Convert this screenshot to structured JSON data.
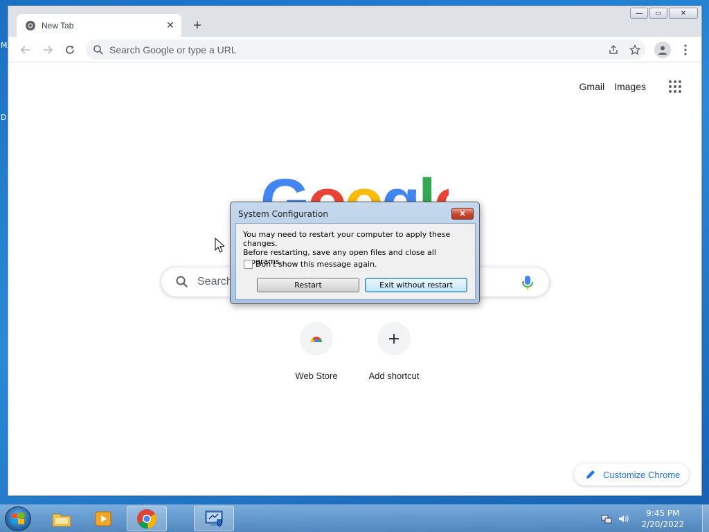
{
  "desktop": {
    "label_1": "M",
    "label_2": "D"
  },
  "browser": {
    "tab_title": "New Tab",
    "tab_close_glyph": "✕",
    "new_tab_glyph": "+",
    "omnibox_placeholder": "Search Google or type a URL",
    "window_controls": {
      "minimize": "—",
      "maximize": "▭",
      "close": "✕"
    }
  },
  "ntp": {
    "top_links": [
      "Gmail",
      "Images"
    ],
    "logo_text": [
      "G",
      "o",
      "o",
      "g",
      "l",
      "e"
    ],
    "search_placeholder": "Search",
    "shortcuts": [
      {
        "label": "Web Store",
        "icon": "webstore-icon"
      },
      {
        "label": "Add shortcut",
        "icon": "plus-icon"
      }
    ],
    "customize_label": "Customize Chrome"
  },
  "dialog": {
    "title": "System Configuration",
    "close_glyph": "✕",
    "message_line1": "You may need to restart your computer to apply these changes.",
    "message_line2": "Before restarting, save any open files and close all programs.",
    "checkbox_label": "Don't show this message again.",
    "restart_label": "Restart",
    "exit_label": "Exit without restart"
  },
  "taskbar": {
    "time": "9:45 PM",
    "date": "2/20/2022"
  },
  "colors": {
    "google_blue": "#4285f4",
    "google_red": "#ea4335",
    "google_yellow": "#fbbc05",
    "google_green": "#34a853",
    "link_blue": "#1a73e8"
  }
}
